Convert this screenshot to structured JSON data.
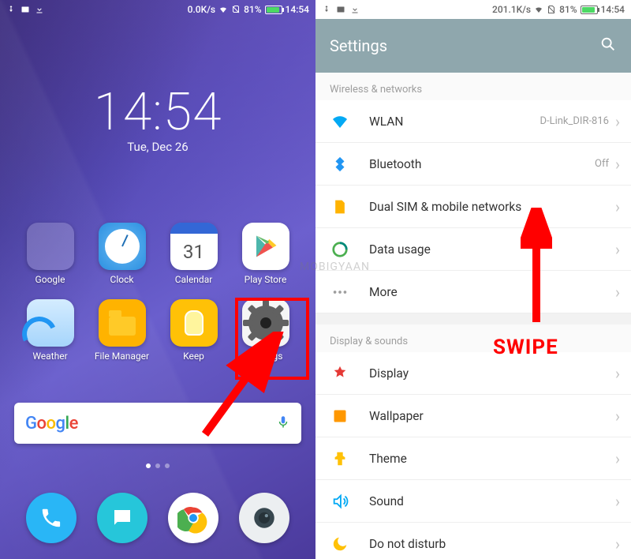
{
  "left": {
    "statusbar": {
      "net_speed": "0.0K/s",
      "battery_pct": "81%",
      "time": "14:54"
    },
    "clock": {
      "time": "14:54",
      "date": "Tue, Dec 26"
    },
    "apps": {
      "google_folder": "Google",
      "clock": "Clock",
      "calendar": "Calendar",
      "calendar_day": "31",
      "play": "Play Store",
      "weather": "Weather",
      "files": "File Manager",
      "keep": "Keep",
      "settings": "Settings"
    },
    "search": {
      "placeholder": "Google"
    }
  },
  "right": {
    "statusbar": {
      "net_speed": "201.1K/s",
      "battery_pct": "81%",
      "time": "14:54"
    },
    "appbar_title": "Settings",
    "section1": "Wireless & networks",
    "rows1": {
      "wlan": {
        "label": "WLAN",
        "value": "D-Link_DIR-816"
      },
      "bt": {
        "label": "Bluetooth",
        "value": "Off"
      },
      "sim": {
        "label": "Dual SIM & mobile networks"
      },
      "data": {
        "label": "Data usage"
      },
      "more": {
        "label": "More"
      }
    },
    "section2": "Display & sounds",
    "rows2": {
      "display": {
        "label": "Display"
      },
      "wallpaper": {
        "label": "Wallpaper"
      },
      "theme": {
        "label": "Theme"
      },
      "sound": {
        "label": "Sound"
      },
      "dnd": {
        "label": "Do not disturb"
      }
    }
  },
  "annotations": {
    "swipe": "SWIPE"
  },
  "watermark": "MOBIGYAAN"
}
